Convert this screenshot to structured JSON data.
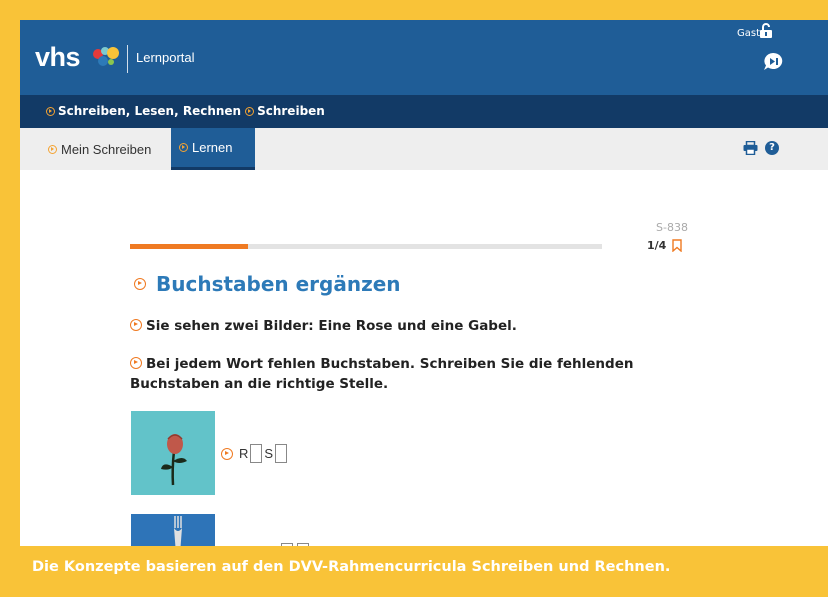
{
  "header": {
    "logo": "vhs",
    "portal": "Lernportal",
    "user": "Gast",
    "icons": [
      "lock-open-icon",
      "chat-icon"
    ]
  },
  "breadcrumb": [
    "Schreiben, Lesen, Rechnen",
    "Schreiben"
  ],
  "tabs": [
    {
      "label": "Mein Schreiben",
      "active": false
    },
    {
      "label": "Lernen",
      "active": true
    }
  ],
  "toolbar_icons": [
    "print-icon",
    "help-icon"
  ],
  "exercise": {
    "code": "S-838",
    "progress": 0.25,
    "page": "1/4",
    "title": "Buchstaben ergänzen",
    "instruction1": "Sie sehen zwei Bilder: Eine Rose und eine Gabel.",
    "instruction2": "Bei jedem Wort fehlen Buchstaben. Schreiben Sie die fehlenden Buchstaben an die richtige Stelle.",
    "word1": {
      "letters": [
        "R",
        "",
        "S",
        ""
      ]
    }
  },
  "banner": "Die Konzepte basieren auf den DVV-Rahmencurricula Schreiben und Rechnen.",
  "colors": {
    "frame": "#f9c338",
    "header_blue": "#1f5d97",
    "dark_blue": "#123a66",
    "accent_orange": "#ef7a22",
    "title_blue": "#2d7ab8"
  }
}
